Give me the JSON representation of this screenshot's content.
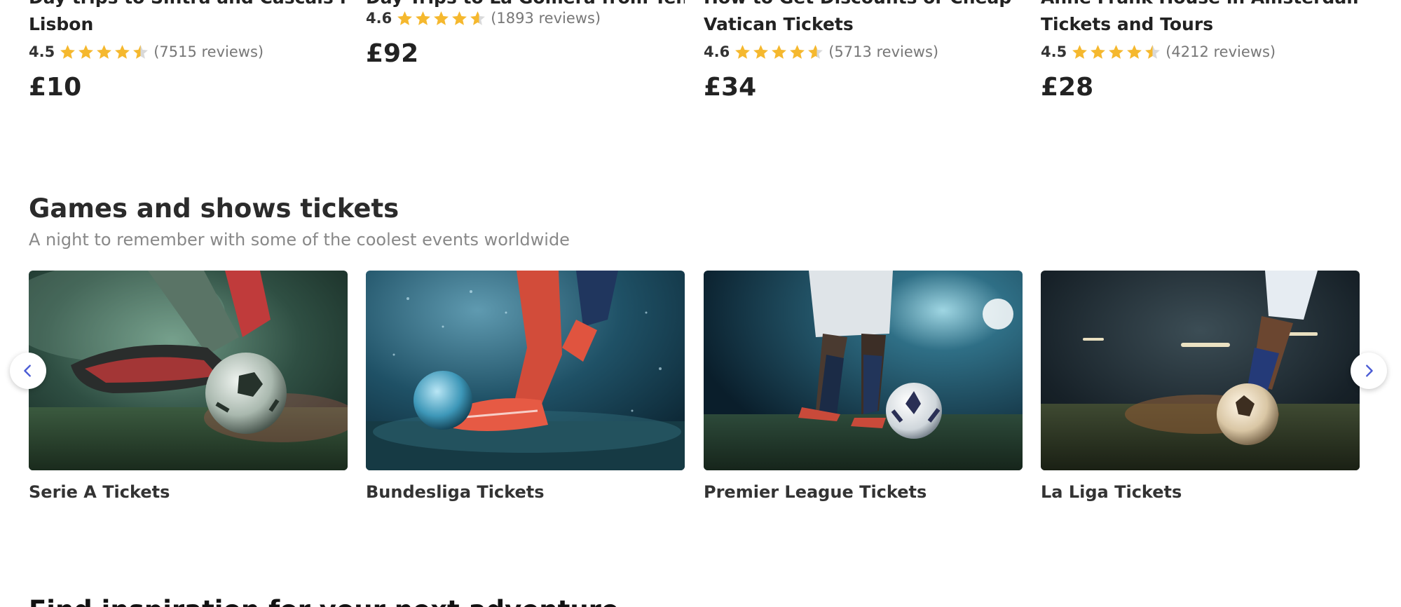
{
  "top_cards": [
    {
      "title_line1": "Day trips to Sintra and Cascais from",
      "title_line2": "Lisbon",
      "score": "4.5",
      "stars": 4.5,
      "reviews": "(7515 reviews)",
      "price": "£10"
    },
    {
      "title_line1": "Day Trips to La Gomera from Tenerife",
      "title_line2": "",
      "score": "4.6",
      "stars": 4.6,
      "reviews": "(1893 reviews)",
      "price": "£92"
    },
    {
      "title_line1": "How to Get Discounts or Cheap",
      "title_line2": "Vatican Tickets",
      "score": "4.6",
      "stars": 4.6,
      "reviews": "(5713 reviews)",
      "price": "£34"
    },
    {
      "title_line1": "Anne Frank House in Amsterdam:",
      "title_line2": "Tickets and Tours",
      "score": "4.5",
      "stars": 4.5,
      "reviews": "(4212 reviews)",
      "price": "£28"
    }
  ],
  "section": {
    "title": "Games and shows tickets",
    "subtitle": "A night to remember with some of the coolest events worldwide"
  },
  "cards": [
    {
      "label": "Serie A Tickets"
    },
    {
      "label": "Bundesliga Tickets"
    },
    {
      "label": "Premier League Tickets"
    },
    {
      "label": "La Liga Tickets"
    }
  ],
  "next_section": {
    "title": "Find inspiration for your next adventure"
  },
  "colors": {
    "star": "#F5B82E",
    "star_empty": "#D9D9D9",
    "arrow": "#4A5BD4"
  },
  "icons": {
    "prev": "chevron-left-icon",
    "next": "chevron-right-icon",
    "star": "star-icon"
  }
}
